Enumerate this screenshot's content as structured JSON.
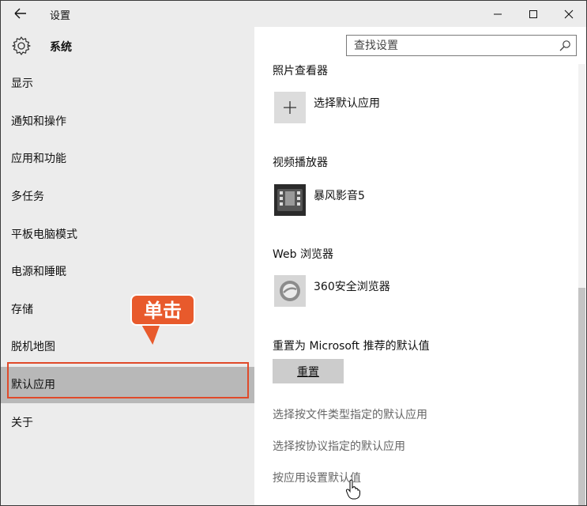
{
  "window": {
    "title": "设置",
    "minimize_label": "—",
    "maximize_label": "☐",
    "close_label": "✕"
  },
  "sidebar": {
    "header": "系统",
    "items": [
      {
        "label": "显示"
      },
      {
        "label": "通知和操作"
      },
      {
        "label": "应用和功能"
      },
      {
        "label": "多任务"
      },
      {
        "label": "平板电脑模式"
      },
      {
        "label": "电源和睡眠"
      },
      {
        "label": "存储"
      },
      {
        "label": "脱机地图"
      },
      {
        "label": "默认应用",
        "selected": true
      },
      {
        "label": "关于"
      }
    ],
    "callout": "单击"
  },
  "search": {
    "placeholder": "查找设置"
  },
  "content": {
    "photo_viewer": {
      "title": "照片查看器",
      "app": "选择默认应用",
      "icon": "plus-icon"
    },
    "video_player": {
      "title": "视频播放器",
      "app": "暴风影音5",
      "icon": "film-icon"
    },
    "web_browser": {
      "title": "Web 浏览器",
      "app": "360安全浏览器",
      "icon": "browser-icon"
    },
    "reset": {
      "title": "重置为 Microsoft 推荐的默认值",
      "button": "重置"
    },
    "links": [
      "选择按文件类型指定的默认应用",
      "选择按协议指定的默认应用",
      "按应用设置默认值"
    ]
  },
  "colors": {
    "sidebar_bg": "#ececec",
    "selected_bg": "#b8b8b8",
    "callout": "#e85a2c",
    "highlight_outline": "#e04a2a"
  }
}
